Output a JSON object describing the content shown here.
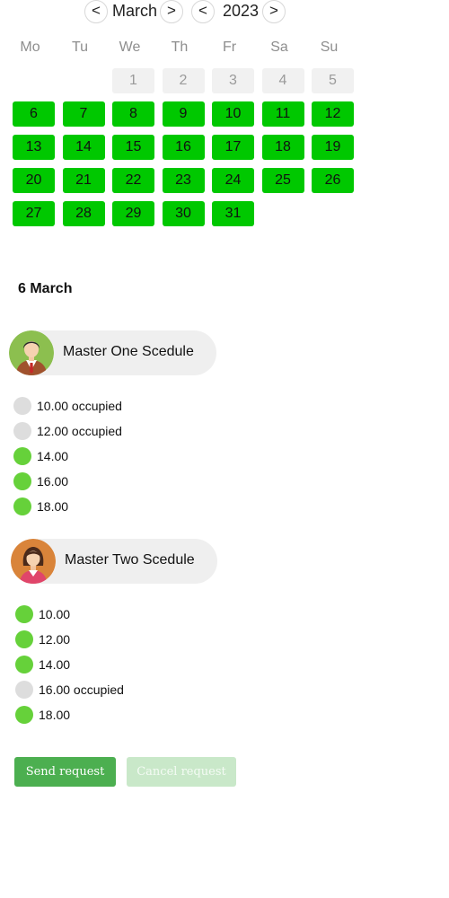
{
  "calendar": {
    "prev_month_symbol": "<",
    "next_month_symbol": ">",
    "month": "March",
    "prev_year_symbol": "<",
    "next_year_symbol": ">",
    "year": "2023",
    "weekdays": [
      "Mo",
      "Tu",
      "We",
      "Th",
      "Fr",
      "Sa",
      "Su"
    ],
    "disabled_days": [
      "1",
      "2",
      "3",
      "4",
      "5"
    ],
    "available_days": [
      "6",
      "7",
      "8",
      "9",
      "10",
      "11",
      "12",
      "13",
      "14",
      "15",
      "16",
      "17",
      "18",
      "19",
      "20",
      "21",
      "22",
      "23",
      "24",
      "25",
      "26",
      "27",
      "28",
      "29",
      "30",
      "31"
    ],
    "colors": {
      "available": "#00c800",
      "disabled": "#f1f1f1"
    }
  },
  "selected_date": "6 March",
  "masters": [
    {
      "name": "Master One Scedule",
      "avatar_icon": "male-avatar-icon",
      "slots": [
        {
          "label": "10.00 occupied",
          "occupied": true
        },
        {
          "label": "12.00 occupied",
          "occupied": true
        },
        {
          "label": "14.00",
          "occupied": false
        },
        {
          "label": "16.00",
          "occupied": false
        },
        {
          "label": "18.00",
          "occupied": false
        }
      ]
    },
    {
      "name": "Master Two Scedule",
      "avatar_icon": "female-avatar-icon",
      "slots": [
        {
          "label": "10.00",
          "occupied": false
        },
        {
          "label": "12.00",
          "occupied": false
        },
        {
          "label": "14.00",
          "occupied": false
        },
        {
          "label": "16.00 occupied",
          "occupied": true
        },
        {
          "label": "18.00",
          "occupied": false
        }
      ]
    }
  ],
  "actions": {
    "send_label": "Send request",
    "cancel_label": "Cancel request",
    "colors": {
      "send": "#4caf50",
      "cancel": "#c9e8c9"
    }
  },
  "slot_colors": {
    "free": "#66d13a",
    "occupied": "#dddddd"
  }
}
